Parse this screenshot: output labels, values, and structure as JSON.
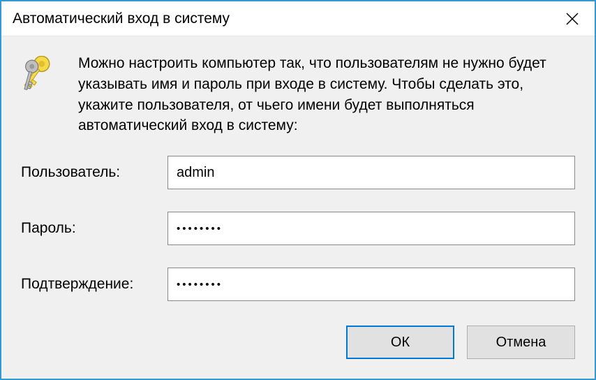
{
  "dialog": {
    "title": "Автоматический вход в систему",
    "description": "Можно настроить компьютер так, что пользователям не нужно будет указывать имя и пароль при входе в систему. Чтобы сделать это, укажите пользователя, от чьего имени будет выполняться автоматический вход в систему:",
    "fields": {
      "username_label": "Пользователь:",
      "username_value": "admin",
      "password_label": "Пароль:",
      "password_value": "••••••••",
      "confirm_label": "Подтверждение:",
      "confirm_value": "••••••••"
    },
    "buttons": {
      "ok": "ОК",
      "cancel": "Отмена"
    }
  }
}
